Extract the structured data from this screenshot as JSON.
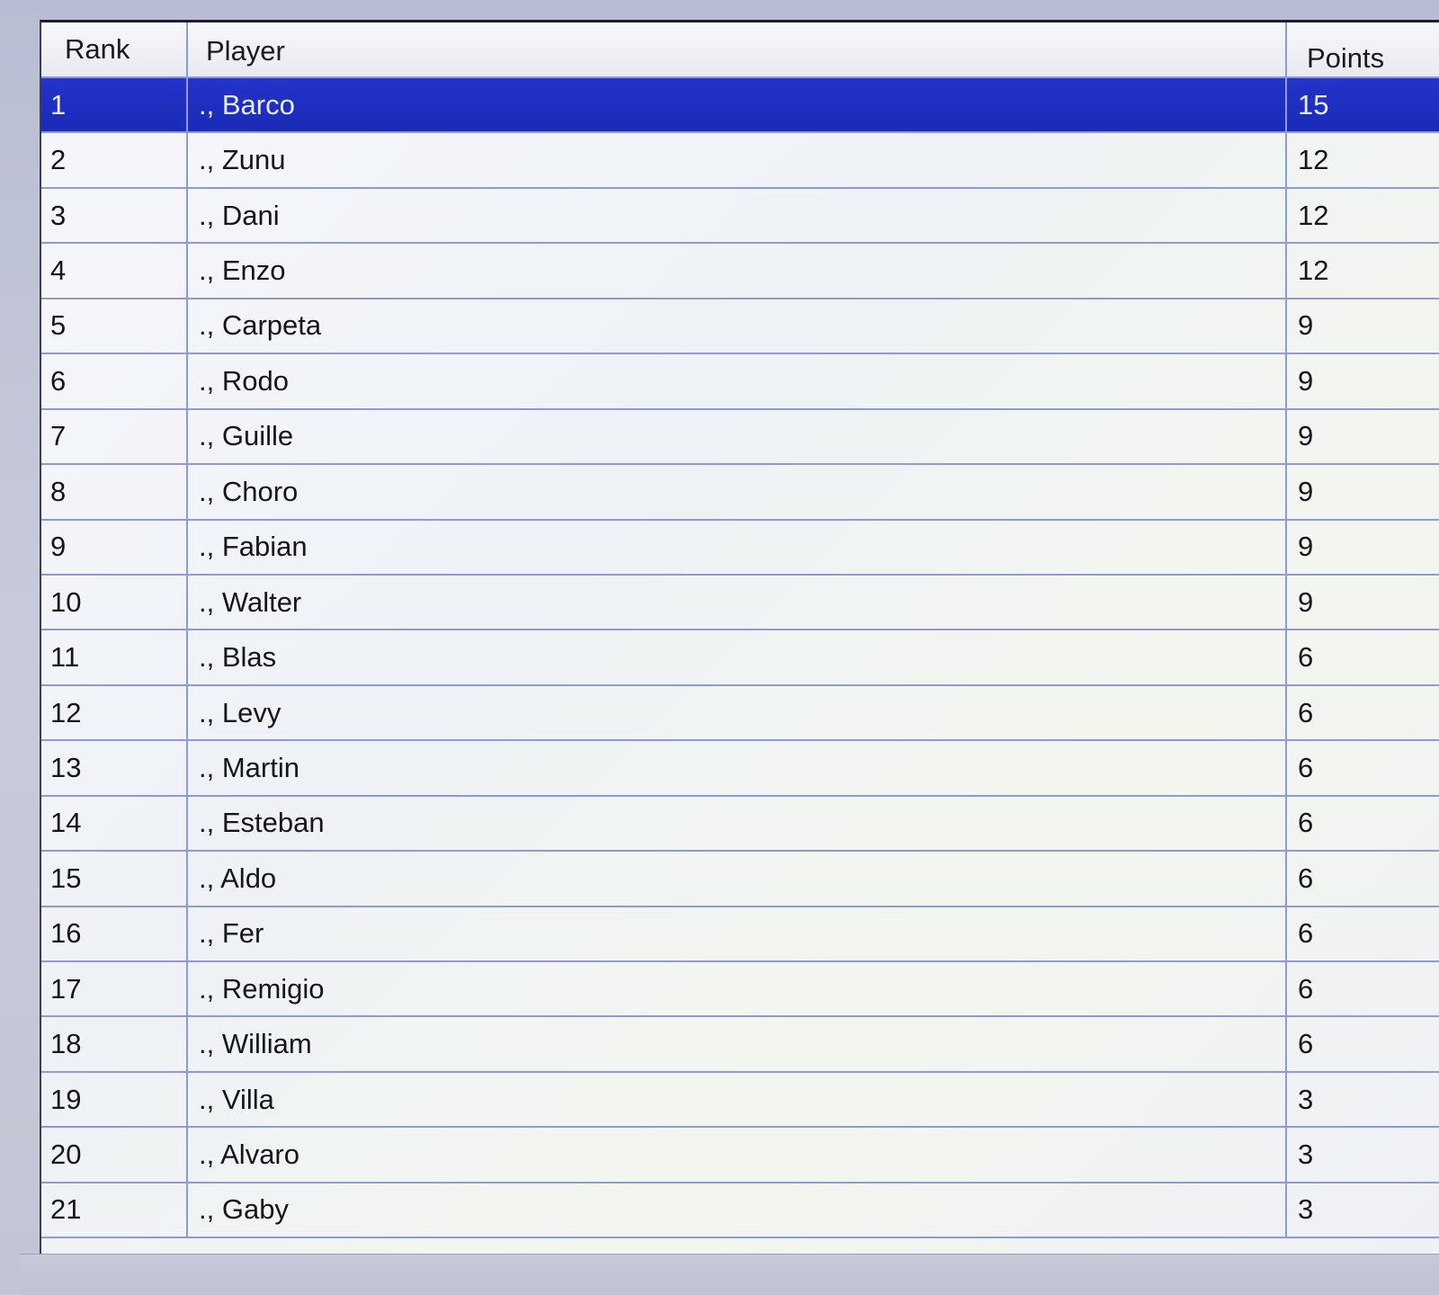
{
  "table": {
    "columns": {
      "rank": "Rank",
      "player": "Player",
      "points": "Points"
    },
    "selected_row_index": 0,
    "rows": [
      {
        "rank": "1",
        "player": "., Barco",
        "points": "15"
      },
      {
        "rank": "2",
        "player": "., Zunu",
        "points": "12"
      },
      {
        "rank": "3",
        "player": "., Dani",
        "points": "12"
      },
      {
        "rank": "4",
        "player": "., Enzo",
        "points": "12"
      },
      {
        "rank": "5",
        "player": "., Carpeta",
        "points": "9"
      },
      {
        "rank": "6",
        "player": "., Rodo",
        "points": "9"
      },
      {
        "rank": "7",
        "player": "., Guille",
        "points": "9"
      },
      {
        "rank": "8",
        "player": "., Choro",
        "points": "9"
      },
      {
        "rank": "9",
        "player": "., Fabian",
        "points": "9"
      },
      {
        "rank": "10",
        "player": "., Walter",
        "points": "9"
      },
      {
        "rank": "11",
        "player": "., Blas",
        "points": "6"
      },
      {
        "rank": "12",
        "player": "., Levy",
        "points": "6"
      },
      {
        "rank": "13",
        "player": "., Martin",
        "points": "6"
      },
      {
        "rank": "14",
        "player": "., Esteban",
        "points": "6"
      },
      {
        "rank": "15",
        "player": "., Aldo",
        "points": "6"
      },
      {
        "rank": "16",
        "player": "., Fer",
        "points": "6"
      },
      {
        "rank": "17",
        "player": "., Remigio",
        "points": "6"
      },
      {
        "rank": "18",
        "player": "., William",
        "points": "6"
      },
      {
        "rank": "19",
        "player": "., Villa",
        "points": "3"
      },
      {
        "rank": "20",
        "player": "., Alvaro",
        "points": "3"
      },
      {
        "rank": "21",
        "player": "., Gaby",
        "points": "3"
      }
    ]
  },
  "colors": {
    "selection": "#1f2fc0",
    "grid_line": "#8f99d6"
  }
}
